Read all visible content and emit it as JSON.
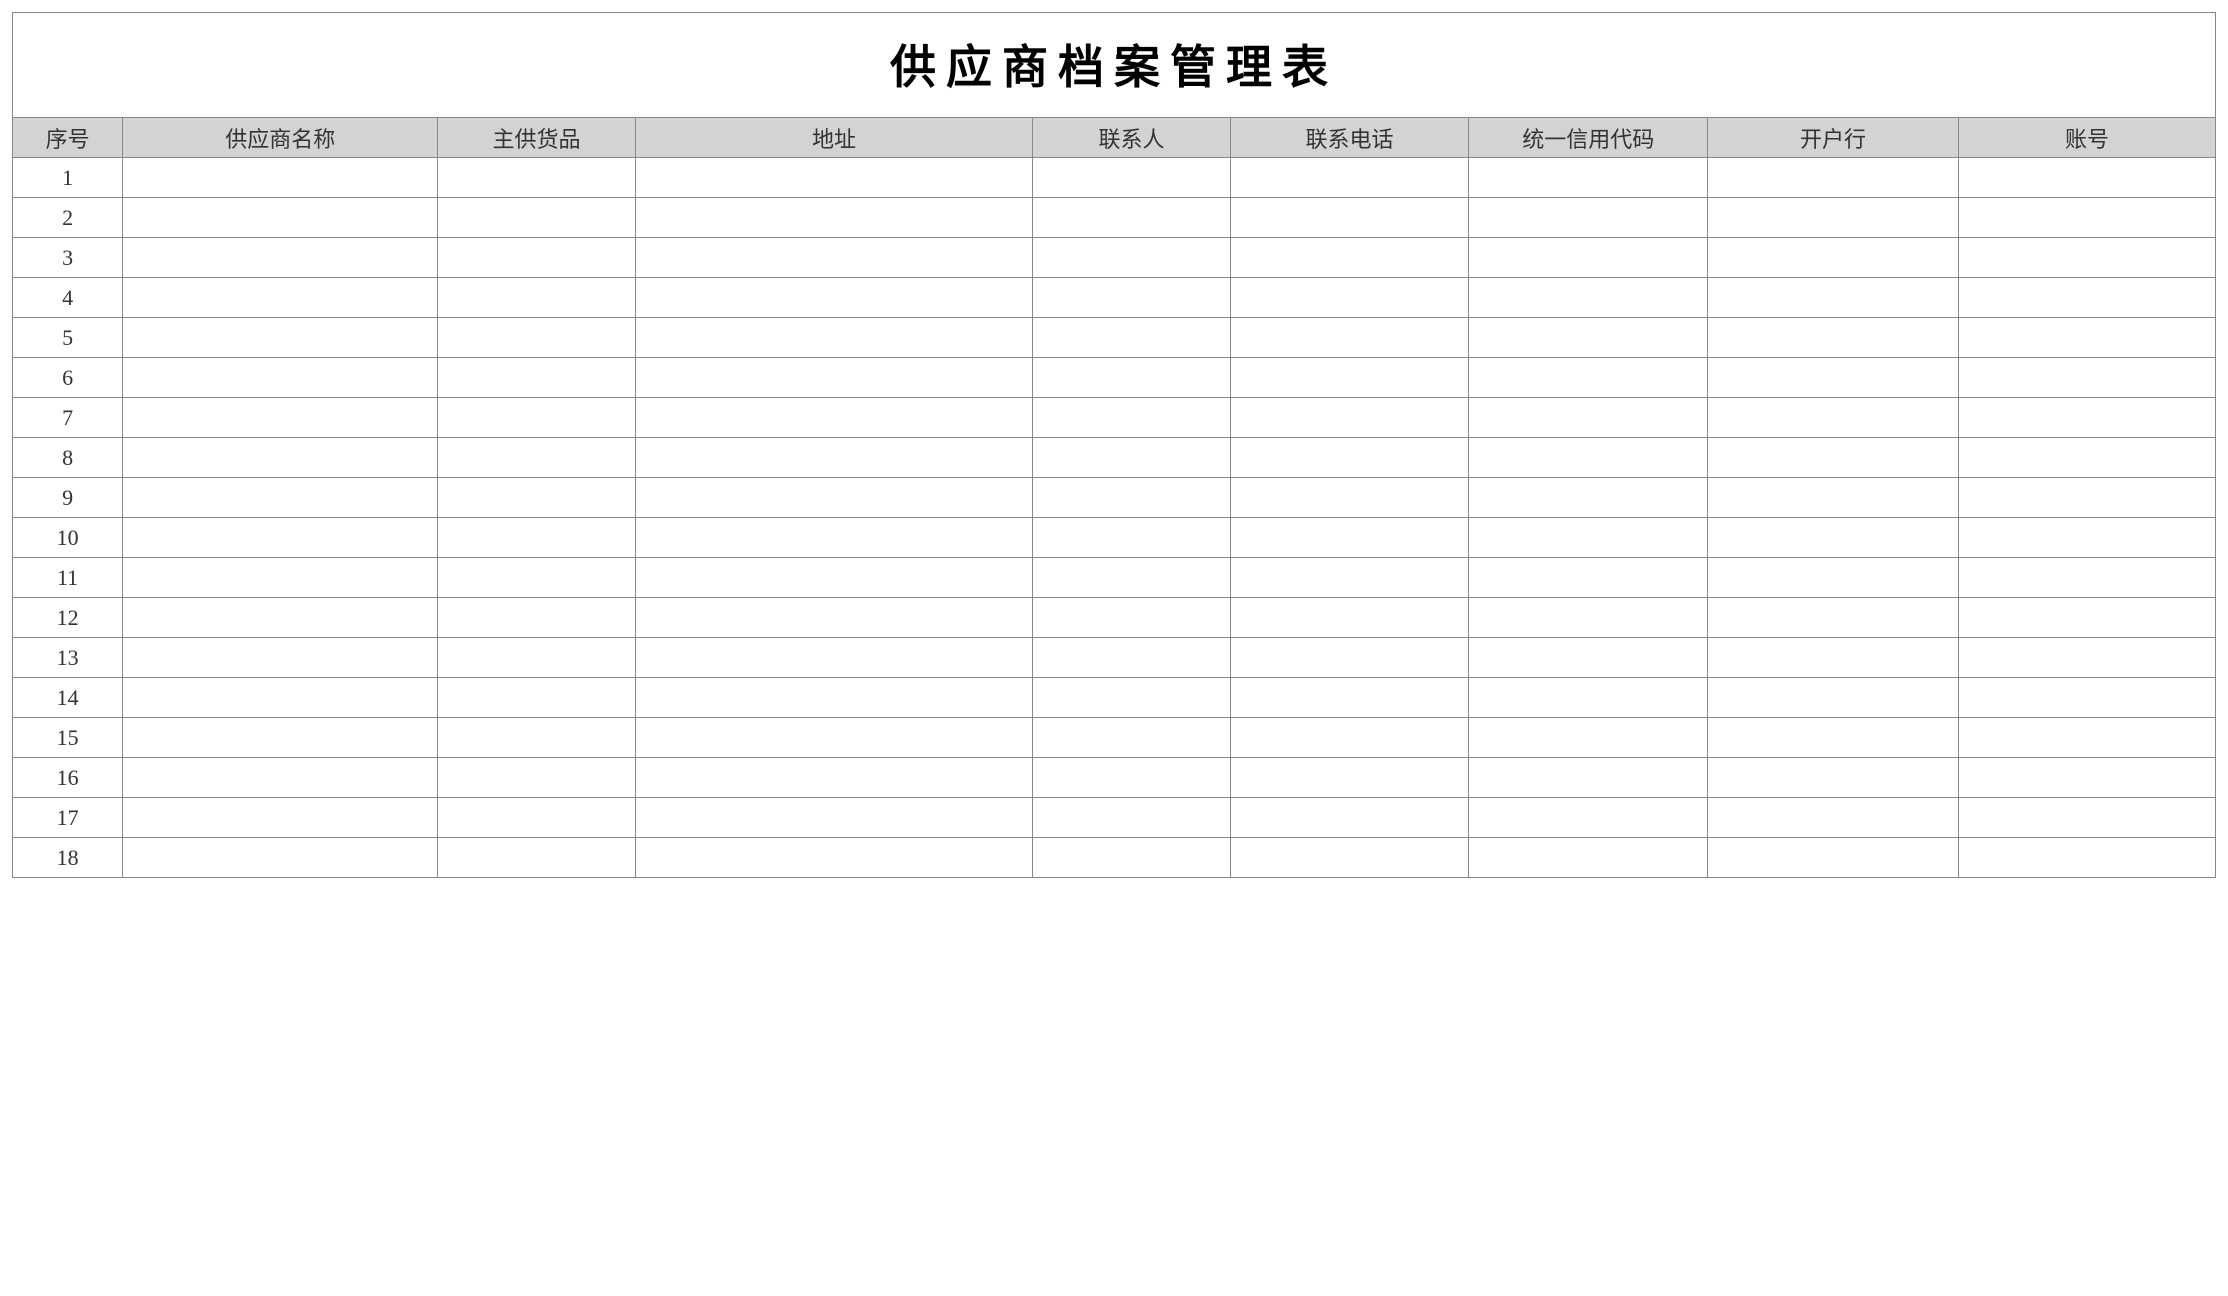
{
  "title": "供应商档案管理表",
  "headers": {
    "seq": "序号",
    "supplier_name": "供应商名称",
    "main_goods": "主供货品",
    "address": "地址",
    "contact": "联系人",
    "phone": "联系电话",
    "credit_code": "统一信用代码",
    "bank": "开户行",
    "account": "账号"
  },
  "rows": [
    {
      "seq": "1",
      "supplier_name": "",
      "main_goods": "",
      "address": "",
      "contact": "",
      "phone": "",
      "credit_code": "",
      "bank": "",
      "account": ""
    },
    {
      "seq": "2",
      "supplier_name": "",
      "main_goods": "",
      "address": "",
      "contact": "",
      "phone": "",
      "credit_code": "",
      "bank": "",
      "account": ""
    },
    {
      "seq": "3",
      "supplier_name": "",
      "main_goods": "",
      "address": "",
      "contact": "",
      "phone": "",
      "credit_code": "",
      "bank": "",
      "account": ""
    },
    {
      "seq": "4",
      "supplier_name": "",
      "main_goods": "",
      "address": "",
      "contact": "",
      "phone": "",
      "credit_code": "",
      "bank": "",
      "account": ""
    },
    {
      "seq": "5",
      "supplier_name": "",
      "main_goods": "",
      "address": "",
      "contact": "",
      "phone": "",
      "credit_code": "",
      "bank": "",
      "account": ""
    },
    {
      "seq": "6",
      "supplier_name": "",
      "main_goods": "",
      "address": "",
      "contact": "",
      "phone": "",
      "credit_code": "",
      "bank": "",
      "account": ""
    },
    {
      "seq": "7",
      "supplier_name": "",
      "main_goods": "",
      "address": "",
      "contact": "",
      "phone": "",
      "credit_code": "",
      "bank": "",
      "account": ""
    },
    {
      "seq": "8",
      "supplier_name": "",
      "main_goods": "",
      "address": "",
      "contact": "",
      "phone": "",
      "credit_code": "",
      "bank": "",
      "account": ""
    },
    {
      "seq": "9",
      "supplier_name": "",
      "main_goods": "",
      "address": "",
      "contact": "",
      "phone": "",
      "credit_code": "",
      "bank": "",
      "account": ""
    },
    {
      "seq": "10",
      "supplier_name": "",
      "main_goods": "",
      "address": "",
      "contact": "",
      "phone": "",
      "credit_code": "",
      "bank": "",
      "account": ""
    },
    {
      "seq": "11",
      "supplier_name": "",
      "main_goods": "",
      "address": "",
      "contact": "",
      "phone": "",
      "credit_code": "",
      "bank": "",
      "account": ""
    },
    {
      "seq": "12",
      "supplier_name": "",
      "main_goods": "",
      "address": "",
      "contact": "",
      "phone": "",
      "credit_code": "",
      "bank": "",
      "account": ""
    },
    {
      "seq": "13",
      "supplier_name": "",
      "main_goods": "",
      "address": "",
      "contact": "",
      "phone": "",
      "credit_code": "",
      "bank": "",
      "account": ""
    },
    {
      "seq": "14",
      "supplier_name": "",
      "main_goods": "",
      "address": "",
      "contact": "",
      "phone": "",
      "credit_code": "",
      "bank": "",
      "account": ""
    },
    {
      "seq": "15",
      "supplier_name": "",
      "main_goods": "",
      "address": "",
      "contact": "",
      "phone": "",
      "credit_code": "",
      "bank": "",
      "account": ""
    },
    {
      "seq": "16",
      "supplier_name": "",
      "main_goods": "",
      "address": "",
      "contact": "",
      "phone": "",
      "credit_code": "",
      "bank": "",
      "account": ""
    },
    {
      "seq": "17",
      "supplier_name": "",
      "main_goods": "",
      "address": "",
      "contact": "",
      "phone": "",
      "credit_code": "",
      "bank": "",
      "account": ""
    },
    {
      "seq": "18",
      "supplier_name": "",
      "main_goods": "",
      "address": "",
      "contact": "",
      "phone": "",
      "credit_code": "",
      "bank": "",
      "account": ""
    }
  ]
}
